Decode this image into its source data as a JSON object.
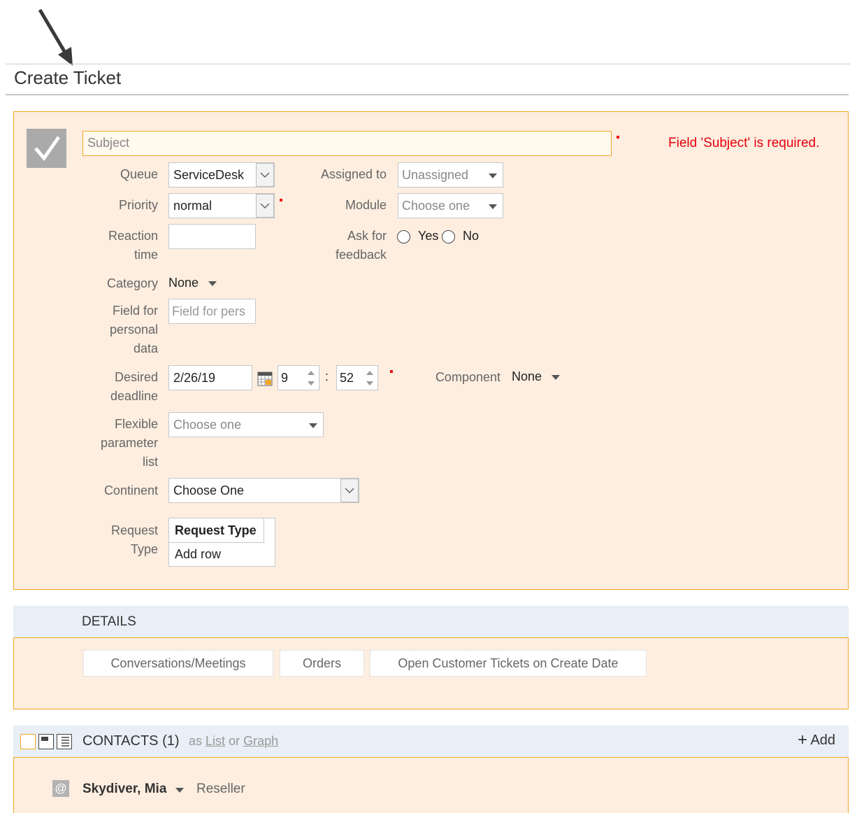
{
  "page": {
    "title": "Create Ticket"
  },
  "form": {
    "subject": {
      "placeholder": "Subject",
      "error": "Field 'Subject' is required."
    },
    "queue": {
      "label": "Queue",
      "value": "ServiceDesk"
    },
    "assigned_to": {
      "label": "Assigned to",
      "value": "Unassigned"
    },
    "priority": {
      "label": "Priority",
      "value": "normal"
    },
    "module": {
      "label": "Module",
      "value": "Choose one"
    },
    "reaction_time": {
      "label_line1": "Reaction",
      "label_line2": "time",
      "value": ""
    },
    "ask_feedback": {
      "label_line1": "Ask for",
      "label_line2": "feedback",
      "yes": "Yes",
      "no": "No"
    },
    "category": {
      "label": "Category",
      "value": "None"
    },
    "personal_data": {
      "label_line1": "Field for",
      "label_line2": "personal",
      "label_line3": "data",
      "placeholder": "Field for pers"
    },
    "desired_deadline": {
      "label_line1": "Desired",
      "label_line2": "deadline",
      "date": "2/26/19",
      "hour": "9",
      "separator": ":",
      "minute": "52"
    },
    "component": {
      "label": "Component",
      "value": "None"
    },
    "flexible_param": {
      "label_line1": "Flexible",
      "label_line2": "parameter",
      "label_line3": "list",
      "value": "Choose one"
    },
    "continent": {
      "label": "Continent",
      "value": "Choose One"
    },
    "request_type": {
      "label_line1": "Request",
      "label_line2": "Type",
      "column_header": "Request Type",
      "add_row": "Add row"
    }
  },
  "details": {
    "title": "DETAILS",
    "tabs": [
      "Conversations/Meetings",
      "Orders",
      "Open Customer Tickets on Create Date"
    ]
  },
  "contacts": {
    "title": "CONTACTS (1)",
    "as_text": "as",
    "list_link": "List",
    "or_text": "or",
    "graph_link": "Graph",
    "add_label": "Add",
    "items": [
      {
        "name": "Skydiver, Mia",
        "role": "Reseller"
      }
    ]
  },
  "colors": {
    "accent_orange": "#f5a623",
    "panel_bg": "#fdeee0",
    "section_header_bg": "#e9eff6",
    "error_red": "#e8000b"
  }
}
